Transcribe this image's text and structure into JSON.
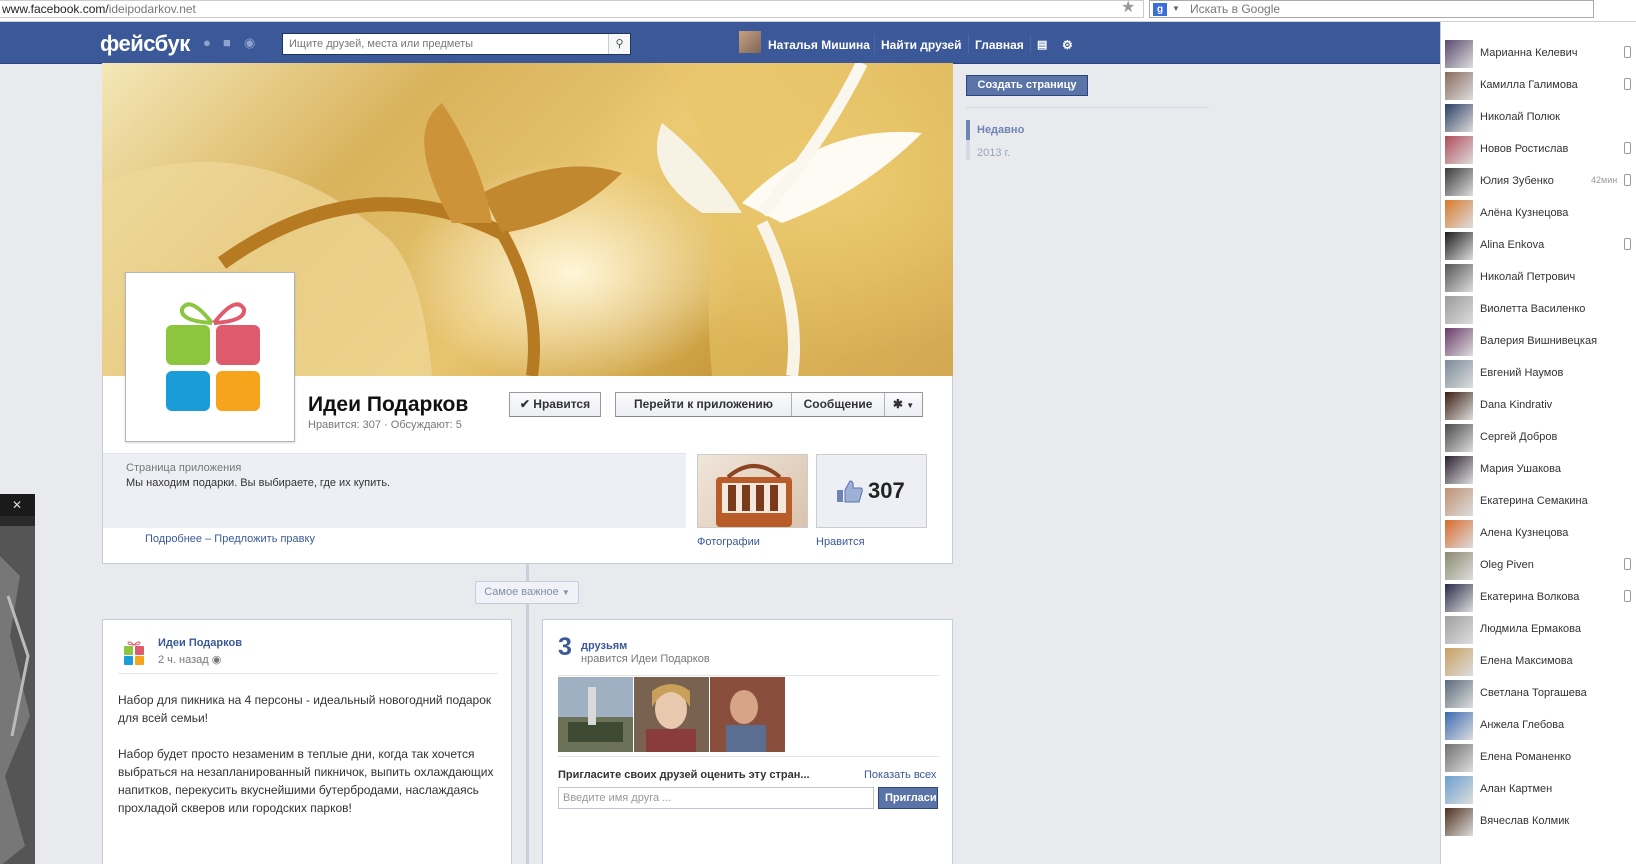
{
  "browser": {
    "url_prefix": "www.facebook.com/",
    "url_path": "ideipodarkov.net",
    "search_placeholder": "Искать в Google"
  },
  "header": {
    "logo": "фейсбук",
    "search_placeholder": "Ищите друзей, места или предметы",
    "user_name": "Наталья Мишина",
    "find_friends": "Найти друзей",
    "home": "Главная"
  },
  "page": {
    "title": "Идеи Подарков",
    "stats": "Нравится: 307 · Обсуждают: 5",
    "like_button": "Нравится",
    "app_button": "Перейти к приложению",
    "message_button": "Сообщение",
    "about_label": "Страница приложения",
    "about_text": "Мы находим подарки. Вы выбираете, где их купить.",
    "more_link": "Подробнее",
    "dash": "–",
    "suggest_link": "Предложить правку",
    "photos_label": "Фотографии",
    "likes_label": "Нравится",
    "likes_count": "307"
  },
  "timeline": {
    "filter": "Самое важное"
  },
  "post": {
    "author": "Идеи Подарков",
    "time": "2 ч. назад",
    "paragraph1": "Набор для пикника на 4 персоны - идеальный новогодний подарок для всей семьи!",
    "paragraph2": "Набор будет просто незаменим в теплые дни, когда так хочется выбраться на незапланированный пикничок, выпить охлаждающих напитков, перекусить вкуснейшими бутербродами, наслаждаясь прохладой скверов или городских парков!"
  },
  "friends_box": {
    "count": "3",
    "title": "друзьям",
    "subtitle": "нравится Идеи Подарков",
    "invite": "Пригласите своих друзей оценить эту стран...",
    "show_all": "Показать всех",
    "input_placeholder": "Введите имя друга ...",
    "invite_button": "Пригласи"
  },
  "right_column": {
    "create_page": "Создать страницу",
    "recent": "Недавно",
    "year": "2013 г."
  },
  "chat": [
    {
      "name": "Марианна Келевич",
      "time": "",
      "mobile": true
    },
    {
      "name": "Камилла Галимова",
      "time": "",
      "mobile": true
    },
    {
      "name": "Николай Полюк",
      "time": "",
      "mobile": false
    },
    {
      "name": "Новов Ростислав",
      "time": "",
      "mobile": true
    },
    {
      "name": "Юлия Зубенко",
      "time": "42мин",
      "mobile": true
    },
    {
      "name": "Алёна Кузнецова",
      "time": "",
      "mobile": false
    },
    {
      "name": "Alina Enkova",
      "time": "",
      "mobile": true
    },
    {
      "name": "Николай Петрович",
      "time": "",
      "mobile": false
    },
    {
      "name": "Виолетта Василенко",
      "time": "",
      "mobile": false
    },
    {
      "name": "Валерия Вишнивецкая",
      "time": "",
      "mobile": false
    },
    {
      "name": "Евгений Наумов",
      "time": "",
      "mobile": false
    },
    {
      "name": "Dana Kindrativ",
      "time": "",
      "mobile": false
    },
    {
      "name": "Сергей Добров",
      "time": "",
      "mobile": false
    },
    {
      "name": "Мария Ушакова",
      "time": "",
      "mobile": false
    },
    {
      "name": "Екатерина Семакина",
      "time": "",
      "mobile": false
    },
    {
      "name": "Алена Кузнецова",
      "time": "",
      "mobile": false
    },
    {
      "name": "Oleg Piven",
      "time": "",
      "mobile": true
    },
    {
      "name": "Екатерина Волкова",
      "time": "",
      "mobile": true
    },
    {
      "name": "Людмила Ермакова",
      "time": "",
      "mobile": false
    },
    {
      "name": "Елена Максимова",
      "time": "",
      "mobile": false
    },
    {
      "name": "Светлана Торгашева",
      "time": "",
      "mobile": false
    },
    {
      "name": "Анжела Глебова",
      "time": "",
      "mobile": false
    },
    {
      "name": "Елена Романенко",
      "time": "",
      "mobile": false
    },
    {
      "name": "Алан Картмен",
      "time": "",
      "mobile": false
    },
    {
      "name": "Вячеслав Колмик",
      "time": "",
      "mobile": false
    }
  ],
  "colors": {
    "fb_blue": "#3b5998",
    "gift_green": "#8cc63f",
    "gift_pink": "#e05a6d",
    "gift_blue": "#1a9cd8",
    "gift_orange": "#f7a41d"
  }
}
